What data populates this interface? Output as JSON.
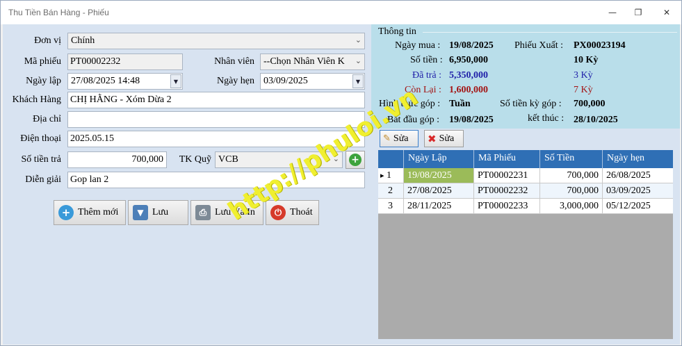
{
  "window": {
    "title": "Thu Tiền Bán Hàng - Phiếu"
  },
  "form": {
    "don_vi_label": "Đơn vị",
    "don_vi_value": "Chính",
    "ma_phieu_label": "Mã phiếu",
    "ma_phieu_value": "PT00002232",
    "nhan_vien_label": "Nhân viên",
    "nhan_vien_value": "--Chọn Nhân Viên K",
    "ngay_lap_label": "Ngày lập",
    "ngay_lap_value": "27/08/2025  14:48",
    "ngay_hen_label": "Ngày hẹn",
    "ngay_hen_value": "03/09/2025",
    "khach_hang_label": "Khách Hàng",
    "khach_hang_value": "CHỊ HẰNG - Xóm Dừa 2",
    "dia_chi_label": "Địa chỉ",
    "dia_chi_value": "",
    "dien_thoai_label": "Điện thoại",
    "dien_thoai_value": "2025.05.15",
    "so_tien_tra_label": "Số tiền trả",
    "so_tien_tra_value": "700,000",
    "tk_quy_label": "TK Quỹ",
    "tk_quy_value": "VCB",
    "dien_giai_label": "Diễn giải",
    "dien_giai_value": "Gop lan 2"
  },
  "buttons": {
    "them_moi": "Thêm mới",
    "luu": "Lưu",
    "luu_va_in": "Lưu Và In",
    "thoat": "Thoát"
  },
  "info": {
    "section_title": "Thông tin",
    "ngay_mua_label": "Ngày mua :",
    "ngay_mua_value": "19/08/2025",
    "phieu_xuat_label": "Phiếu Xuất :",
    "phieu_xuat_value": "PX00023194",
    "so_tien_label": "Số tiền :",
    "so_tien_value": "6,950,000",
    "so_ky": "10 Kỳ",
    "da_tra_label": "Đã trả :",
    "da_tra_value": "5,350,000",
    "da_tra_ky": "3 Kỳ",
    "con_lai_label": "Còn Lại :",
    "con_lai_value": "1,600,000",
    "con_lai_ky": "7 Kỳ",
    "hinh_thuc_label": "Hình thức góp :",
    "hinh_thuc_value": "Tuần",
    "so_tien_ky_label": "Số tiền kỳ góp :",
    "so_tien_ky_value": "700,000",
    "bat_dau_label": "Bắt đầu góp :",
    "bat_dau_value": "19/08/2025",
    "ket_thuc_label": "kết thúc :",
    "ket_thuc_value": "28/10/2025",
    "sua_button_1": "Sửa",
    "sua_button_2": "Sửa"
  },
  "grid": {
    "columns": [
      "Ngày Lập",
      "Mã Phiếu",
      "Số Tiền",
      "Ngày hẹn"
    ],
    "rows": [
      {
        "index": "1",
        "ngay_lap": "19/08/2025",
        "ma_phieu": "PT00002231",
        "so_tien": "700,000",
        "ngay_hen": "26/08/2025"
      },
      {
        "index": "2",
        "ngay_lap": "27/08/2025",
        "ma_phieu": "PT00002232",
        "so_tien": "700,000",
        "ngay_hen": "03/09/2025"
      },
      {
        "index": "3",
        "ngay_lap": "28/11/2025",
        "ma_phieu": "PT00002233",
        "so_tien": "3,000,000",
        "ngay_hen": "05/12/2025"
      }
    ],
    "row_marker": "▸"
  },
  "watermark": "http://phuloi.vn",
  "colors": {
    "grid_header": "#2f6fb5",
    "selected_cell": "#9bbb59",
    "da_tra": "#1f1fa8",
    "con_lai": "#a31515"
  }
}
